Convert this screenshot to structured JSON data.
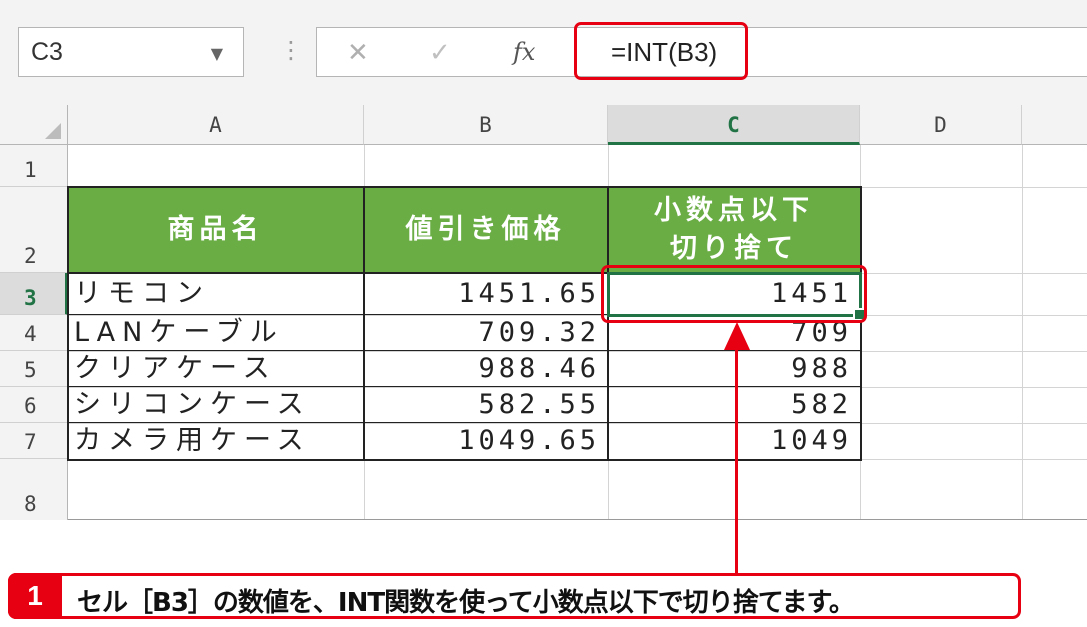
{
  "formula_bar": {
    "name_box": "C3",
    "name_box_arrow": "▼",
    "separator": "⋮",
    "cancel_icon": "✕",
    "enter_icon": "✓",
    "fx_label": "fx",
    "formula": "=INT(B3)"
  },
  "columns": [
    "A",
    "B",
    "C",
    "D"
  ],
  "rows": [
    "1",
    "2",
    "3",
    "4",
    "5",
    "6",
    "7",
    "8"
  ],
  "selected_cell": "C3",
  "table": {
    "headers": [
      "商品名",
      "値引き価格",
      "小数点以下\n切り捨て"
    ],
    "rows": [
      {
        "name": "リモコン",
        "price": "1451.65",
        "int": "1451"
      },
      {
        "name": "LANケーブル",
        "price": "709.32",
        "int": "709"
      },
      {
        "name": "クリアケース",
        "price": "988.46",
        "int": "988"
      },
      {
        "name": "シリコンケース",
        "price": "582.55",
        "int": "582"
      },
      {
        "name": "カメラ用ケース",
        "price": "1049.65",
        "int": "1049"
      }
    ]
  },
  "callout": {
    "number": "1",
    "text": "セル［B3］の数値を、INT関数を使って小数点以下で切り捨てます。"
  },
  "colors": {
    "header_green": "#6aad45",
    "excel_green": "#217346",
    "annotation_red": "#e60012"
  }
}
